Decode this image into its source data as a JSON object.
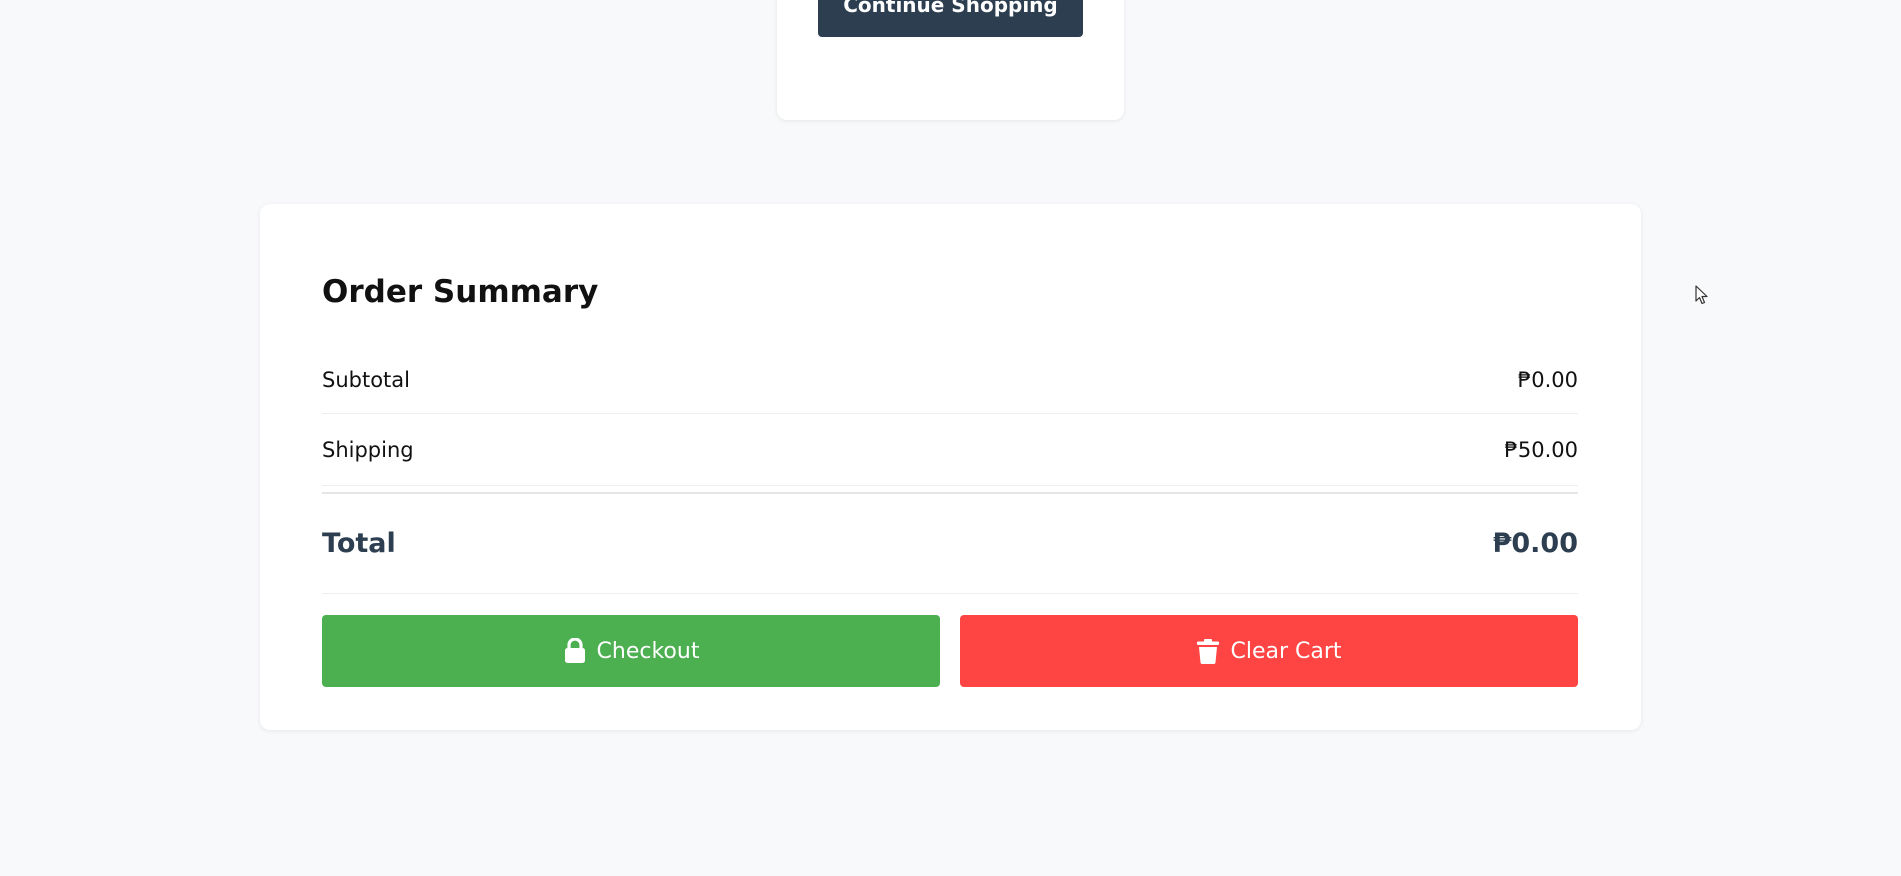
{
  "top_card": {
    "continue_label": "Continue Shopping"
  },
  "order_summary": {
    "title": "Order Summary",
    "subtotal_label": "Subtotal",
    "subtotal_value": "₱0.00",
    "shipping_label": "Shipping",
    "shipping_value": "₱50.00",
    "total_label": "Total",
    "total_value": "₱0.00"
  },
  "actions": {
    "checkout_label": "Checkout",
    "checkout_icon": "lock-icon",
    "clear_label": "Clear Cart",
    "clear_icon": "trash-icon"
  },
  "colors": {
    "page_bg": "#f8f9fa",
    "dark_accent": "#2c3e50",
    "checkout_green": "#4caf50",
    "clear_red": "#ff4444"
  }
}
